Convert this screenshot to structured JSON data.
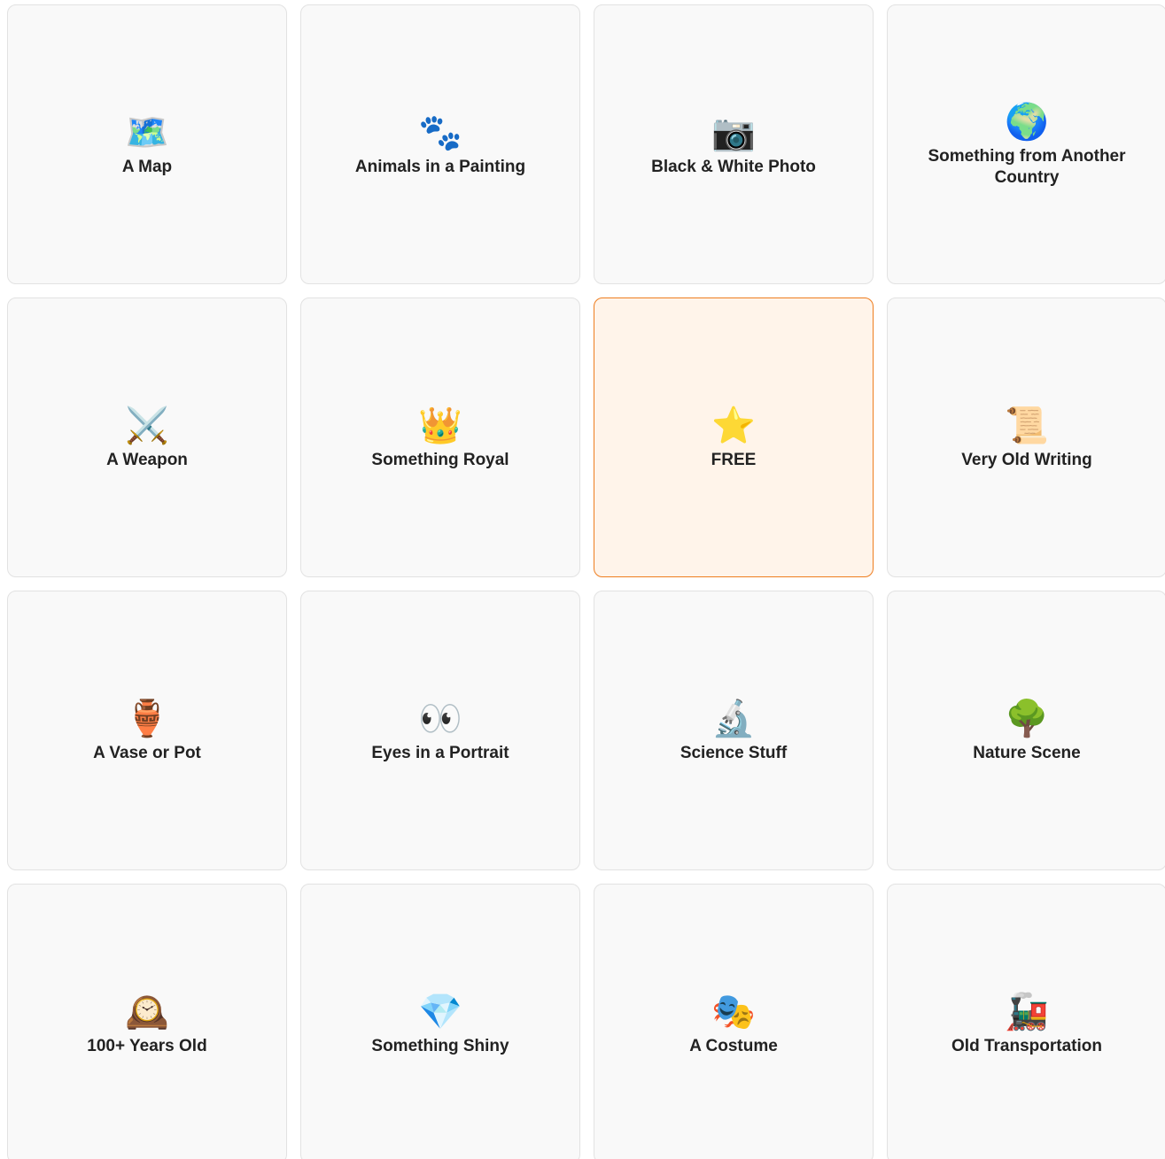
{
  "board": {
    "cells": [
      {
        "icon": "🗺️",
        "icon_name": "map-icon",
        "label": "A Map"
      },
      {
        "icon": "🐾",
        "icon_name": "paw-prints-icon",
        "label": "Animals in a Painting"
      },
      {
        "icon": "📷",
        "icon_name": "camera-icon",
        "label": "Black & White Photo"
      },
      {
        "icon": "🌍",
        "icon_name": "globe-icon",
        "label": "Something from Another Country"
      },
      {
        "icon": "⚔️",
        "icon_name": "crossed-swords-icon",
        "label": "A Weapon"
      },
      {
        "icon": "👑",
        "icon_name": "crown-icon",
        "label": "Something Royal"
      },
      {
        "icon": "⭐",
        "icon_name": "star-icon",
        "label": "FREE"
      },
      {
        "icon": "📜",
        "icon_name": "scroll-icon",
        "label": "Very Old Writing"
      },
      {
        "icon": "🏺",
        "icon_name": "amphora-icon",
        "label": "A Vase or Pot"
      },
      {
        "icon": "👀",
        "icon_name": "eyes-icon",
        "label": "Eyes in a Portrait"
      },
      {
        "icon": "🔬",
        "icon_name": "microscope-icon",
        "label": "Science Stuff"
      },
      {
        "icon": "🌳",
        "icon_name": "tree-icon",
        "label": "Nature Scene"
      },
      {
        "icon": "🕰️",
        "icon_name": "mantel-clock-icon",
        "label": "100+ Years Old"
      },
      {
        "icon": "💎",
        "icon_name": "gem-icon",
        "label": "Something Shiny"
      },
      {
        "icon": "🎭",
        "icon_name": "theater-masks-icon",
        "label": "A Costume"
      },
      {
        "icon": "🚂",
        "icon_name": "locomotive-icon",
        "label": "Old Transportation"
      }
    ],
    "free_cell_index": 6
  },
  "colors": {
    "cell_bg": "#f9f9f9",
    "cell_border": "#e2e2e2",
    "free_bg": "#fff4ea",
    "free_border": "#ee7d1f",
    "text": "#222222"
  }
}
